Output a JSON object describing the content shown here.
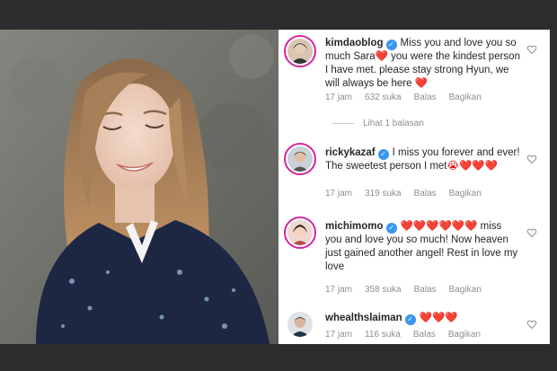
{
  "comments": [
    {
      "username": "kimdaoblog",
      "text": "Miss you and love you so much Sara",
      "heart_after_name": "❤️",
      "text2": " you were the kindest person I have met. please stay strong Hyun, we will always be here ",
      "trailing": "❤️",
      "time": "17 jam",
      "likes": "632 suka",
      "reply": "Balas",
      "share": "Bagikan"
    },
    {
      "username": "rickykazaf",
      "text": "I miss you forever and ever! The sweetest person I met",
      "trailing": "😭❤️❤️❤️",
      "time": "17 jam",
      "likes": "319 suka",
      "reply": "Balas",
      "share": "Bagikan"
    },
    {
      "username": "michimomo",
      "lead": "❤️❤️❤️❤️❤️❤️",
      "text": " miss you and love you so much! Now heaven just gained another angel! Rest in love my love",
      "time": "17 jam",
      "likes": "358 suka",
      "reply": "Balas",
      "share": "Bagikan"
    },
    {
      "username": "whealthslaiman",
      "lead": "❤️❤️❤️",
      "time": "17 jam",
      "likes": "116 suka",
      "reply": "Balas",
      "share": "Bagikan"
    }
  ],
  "view_replies": "Lihat 1 balasan",
  "colors": {
    "frame": "#2b2d2f",
    "verified": "#3897f0",
    "heart": "#e0161b",
    "meta": "#8e8e8e",
    "story_ring": "#d6249f"
  }
}
